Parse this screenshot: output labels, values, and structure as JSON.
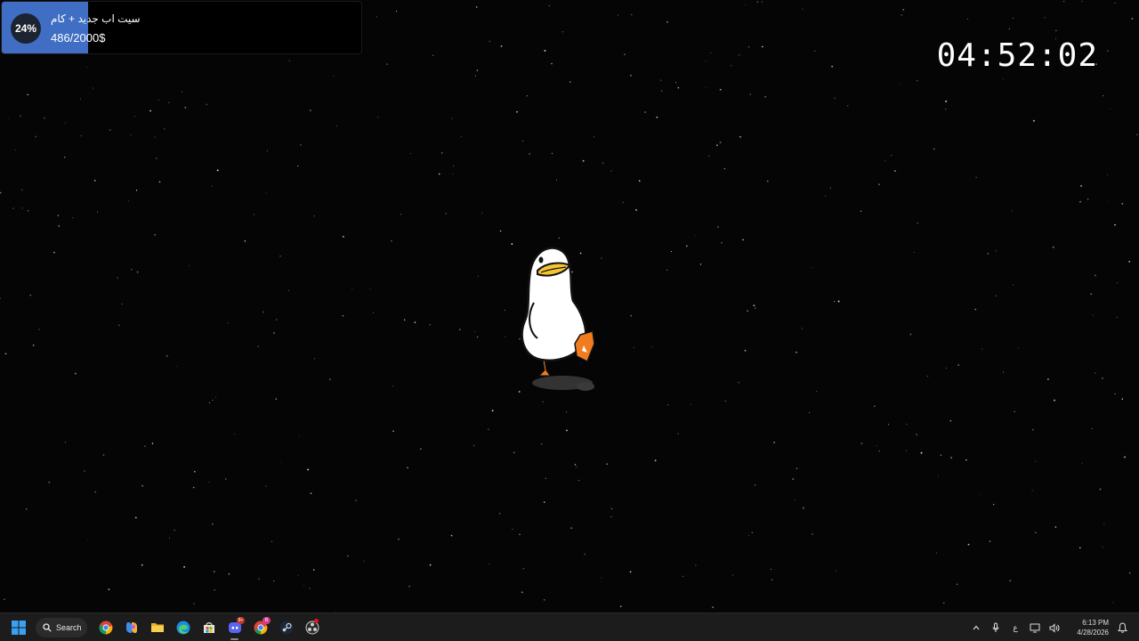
{
  "goal_widget": {
    "percent_label": "24%",
    "progress_fraction": 0.24,
    "title": "سيت اب جديد + كام",
    "amount": "486/2000$",
    "fill_color": "#3f6ec4"
  },
  "timer": {
    "value": "04:52:02"
  },
  "desktop": {
    "background_color": "#050505",
    "character": "duck"
  },
  "taskbar": {
    "search_label": "Search",
    "apps": [
      {
        "name": "chrome-icon"
      },
      {
        "name": "copilot-icon"
      },
      {
        "name": "file-explorer-icon"
      },
      {
        "name": "edge-icon"
      },
      {
        "name": "microsoft-store-icon"
      },
      {
        "name": "discord-icon",
        "badge": "9+"
      },
      {
        "name": "chrome-profile-icon",
        "badge": "R"
      },
      {
        "name": "steam-icon"
      },
      {
        "name": "obs-icon"
      }
    ],
    "tray": {
      "language": "ع",
      "time": "6:13 PM",
      "date": "4/28/2026"
    }
  }
}
